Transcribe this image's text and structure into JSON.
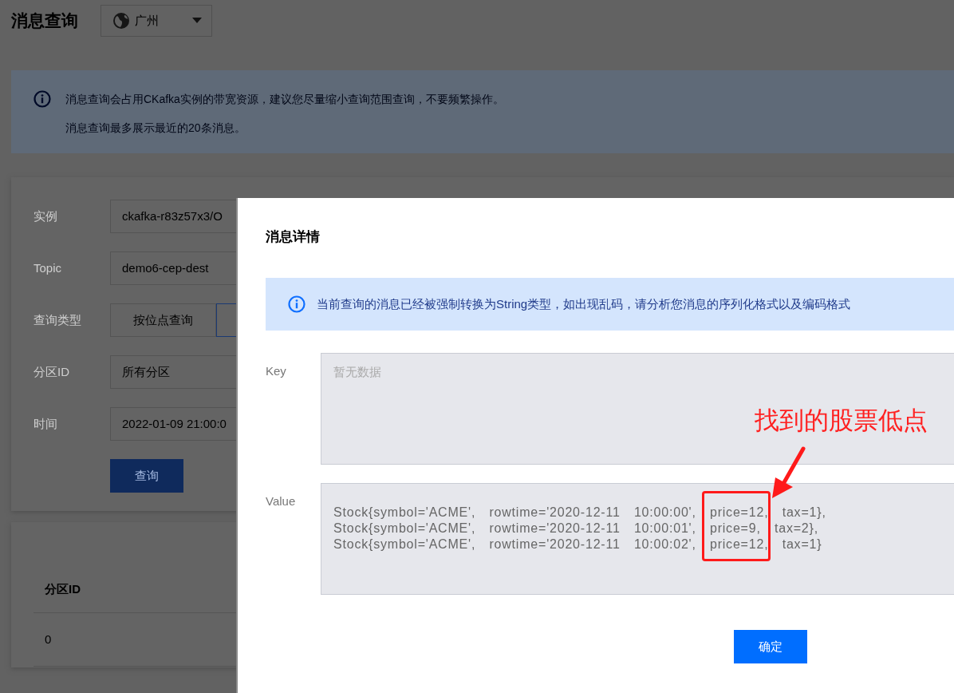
{
  "page": {
    "title": "消息查询",
    "region": "广州"
  },
  "notice": {
    "lines": [
      "消息查询会占用CKafka实例的带宽资源，建议您尽量缩小查询范围查询，不要频繁操作。",
      "消息查询最多展示最近的20条消息。"
    ]
  },
  "form": {
    "fields": [
      {
        "label": "实例",
        "kind": "input",
        "value": "ckafka-r83z57x3/O"
      },
      {
        "label": "Topic",
        "kind": "input",
        "value": "demo6-cep-dest"
      },
      {
        "label": "查询类型",
        "kind": "segmented",
        "options": [
          {
            "label": "按位点查询",
            "selected": false
          },
          {
            "selected": true
          }
        ]
      },
      {
        "label": "分区ID",
        "kind": "input",
        "value": "所有分区"
      },
      {
        "label": "时间",
        "kind": "input",
        "value": "2022-01-09 21:00:0"
      }
    ],
    "submit": "查询"
  },
  "table": {
    "columns": [
      "分区ID"
    ],
    "rows": [
      [
        "0"
      ]
    ]
  },
  "modal": {
    "title": "消息详情",
    "notice": "当前查询的消息已经被强制转换为String类型，如出现乱码，请分析您消息的序列化格式以及编码格式",
    "key": {
      "label": "Key",
      "placeholder": "暂无数据"
    },
    "value": {
      "label": "Value",
      "lines": [
        "Stock{symbol='ACME', rowtime='2020-12-11 10:00:00', price=12, tax=1},",
        "Stock{symbol='ACME', rowtime='2020-12-11 10:00:01', price=9, tax=2},",
        "Stock{symbol='ACME', rowtime='2020-12-11 10:00:02', price=12, tax=1}"
      ]
    },
    "confirm": "确定"
  },
  "annotation": {
    "text": "找到的股票低点"
  }
}
